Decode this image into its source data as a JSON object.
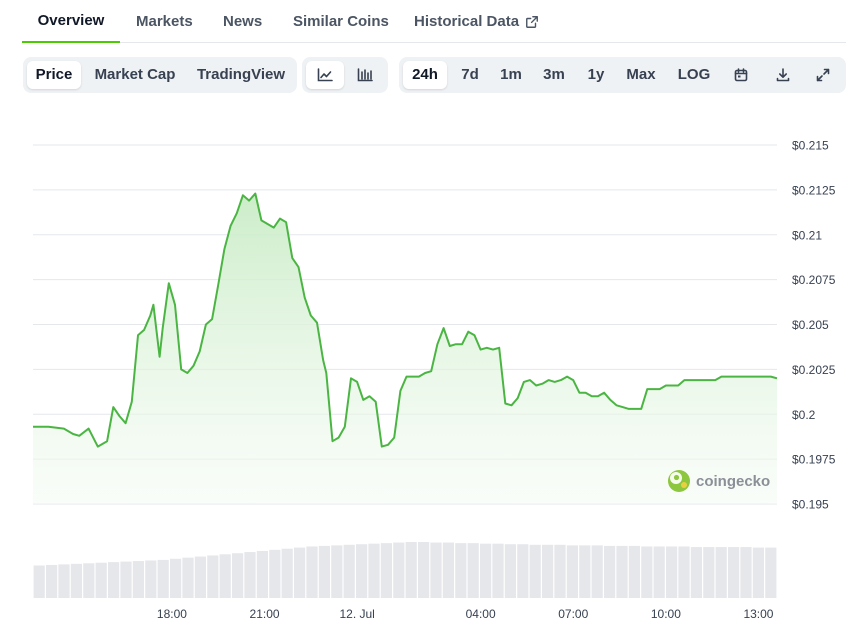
{
  "tabs": [
    {
      "label": "Overview"
    },
    {
      "label": "Markets"
    },
    {
      "label": "News"
    },
    {
      "label": "Similar Coins"
    },
    {
      "label": "Historical Data"
    }
  ],
  "toolbar": {
    "data_types": [
      "Price",
      "Market Cap",
      "TradingView"
    ],
    "active_data_type": "Price",
    "chart_types": [
      "line-chart-icon",
      "candlestick-chart-icon"
    ],
    "active_chart_type": "line-chart-icon",
    "ranges": [
      "24h",
      "7d",
      "1m",
      "3m",
      "1y",
      "Max",
      "LOG"
    ],
    "active_range": "24h",
    "actions": [
      "calendar-icon",
      "download-icon",
      "fullscreen-icon"
    ]
  },
  "watermark": "coingecko",
  "colors": {
    "line": "#4bb543",
    "area_top": "#c9ecc6",
    "volume": "#e5e7eb",
    "grid": "#e5e7eb",
    "accent": "#4bcc00"
  },
  "chart_data": {
    "type": "line",
    "title": "",
    "xlabel": "",
    "ylabel": "",
    "ylim": [
      0.195,
      0.215
    ],
    "ytick_labels": [
      "$0.195",
      "$0.1975",
      "$0.2",
      "$0.2025",
      "$0.205",
      "$0.2075",
      "$0.21",
      "$0.2125",
      "$0.215"
    ],
    "ytick_values": [
      0.195,
      0.1975,
      0.2,
      0.2025,
      0.205,
      0.2075,
      0.21,
      0.2125,
      0.215
    ],
    "x_label_positions_hours": [
      3,
      6,
      9,
      12,
      16,
      19,
      22,
      25
    ],
    "x_tick_labels": [
      "18:00",
      "21:00",
      "12. Jul",
      "04:00",
      "07:00",
      "10:00",
      "13:00"
    ],
    "x_tick_hours": [
      18,
      21,
      24,
      28,
      31,
      34,
      37
    ],
    "x_range_hours": [
      13.5,
      37.6
    ],
    "series": [
      {
        "x": [
          13.5,
          14.0,
          14.5,
          14.8,
          15.0,
          15.3,
          15.6,
          15.9,
          16.1,
          16.3,
          16.5,
          16.7,
          16.9,
          17.1,
          17.3,
          17.4,
          17.6,
          17.7,
          17.9,
          18.1,
          18.3,
          18.5,
          18.7,
          18.9,
          19.1,
          19.3,
          19.5,
          19.7,
          19.9,
          20.1,
          20.3,
          20.5,
          20.7,
          20.9,
          21.1,
          21.3,
          21.5,
          21.7,
          21.9,
          22.1,
          22.3,
          22.5,
          22.7,
          22.9,
          23.0,
          23.2,
          23.4,
          23.6,
          23.8,
          24.0,
          24.2,
          24.4,
          24.6,
          24.8,
          25.0,
          25.2,
          25.4,
          25.6,
          25.8,
          26.0,
          26.2,
          26.4,
          26.6,
          26.8,
          27.0,
          27.2,
          27.4,
          27.6,
          27.8,
          28.0,
          28.2,
          28.4,
          28.6,
          28.8,
          29.0,
          29.2,
          29.4,
          29.6,
          29.8,
          30.0,
          30.2,
          30.4,
          30.6,
          30.8,
          31.0,
          31.2,
          31.4,
          31.6,
          31.8,
          32.0,
          32.2,
          32.4,
          32.6,
          32.8,
          33.0,
          33.2,
          33.4,
          33.6,
          33.8,
          34.0,
          34.2,
          34.4,
          34.6,
          34.8,
          35.0,
          35.2,
          35.4,
          35.6,
          35.8,
          36.0,
          36.2,
          36.4,
          36.6,
          36.8,
          37.0,
          37.2,
          37.4,
          37.6
        ],
        "y": [
          0.1993,
          0.1993,
          0.1992,
          0.1989,
          0.1988,
          0.1992,
          0.1982,
          0.1985,
          0.2004,
          0.1999,
          0.1995,
          0.2007,
          0.2044,
          0.2047,
          0.2055,
          0.2061,
          0.2032,
          0.2048,
          0.2073,
          0.2061,
          0.2025,
          0.2023,
          0.2027,
          0.2035,
          0.205,
          0.2053,
          0.2072,
          0.2092,
          0.2105,
          0.2112,
          0.2122,
          0.2119,
          0.2123,
          0.2108,
          0.2106,
          0.2104,
          0.2109,
          0.2107,
          0.2087,
          0.2082,
          0.2065,
          0.2055,
          0.2051,
          0.203,
          0.2023,
          0.1985,
          0.1987,
          0.1993,
          0.202,
          0.2018,
          0.2008,
          0.201,
          0.2007,
          0.1982,
          0.1983,
          0.1987,
          0.2013,
          0.2021,
          0.2021,
          0.2021,
          0.2023,
          0.2024,
          0.2039,
          0.2048,
          0.2038,
          0.2039,
          0.2039,
          0.2046,
          0.2044,
          0.2036,
          0.2037,
          0.2036,
          0.2037,
          0.2006,
          0.2005,
          0.2009,
          0.2018,
          0.2019,
          0.2016,
          0.2017,
          0.2019,
          0.2018,
          0.2019,
          0.2021,
          0.2019,
          0.2012,
          0.2012,
          0.201,
          0.201,
          0.2012,
          0.2008,
          0.2005,
          0.2004,
          0.2003,
          0.2003,
          0.2003,
          0.2014,
          0.2014,
          0.2014,
          0.2016,
          0.2016,
          0.2016,
          0.2019,
          0.2019,
          0.2019,
          0.2019,
          0.2019,
          0.2019,
          0.2021,
          0.2021,
          0.2021,
          0.2021,
          0.2021,
          0.2021,
          0.2021,
          0.2021,
          0.2021,
          0.202
        ]
      }
    ],
    "volume": {
      "relative_levels": [
        0.58,
        0.59,
        0.6,
        0.61,
        0.62,
        0.63,
        0.64,
        0.65,
        0.66,
        0.67,
        0.68,
        0.7,
        0.72,
        0.74,
        0.76,
        0.78,
        0.8,
        0.82,
        0.84,
        0.86,
        0.88,
        0.9,
        0.92,
        0.93,
        0.94,
        0.95,
        0.96,
        0.97,
        0.98,
        0.99,
        1.0,
        1.0,
        0.99,
        0.99,
        0.98,
        0.98,
        0.97,
        0.97,
        0.96,
        0.96,
        0.95,
        0.95,
        0.95,
        0.94,
        0.94,
        0.94,
        0.93,
        0.93,
        0.93,
        0.92,
        0.92,
        0.92,
        0.92,
        0.91,
        0.91,
        0.91,
        0.91,
        0.91,
        0.9,
        0.9
      ]
    }
  }
}
